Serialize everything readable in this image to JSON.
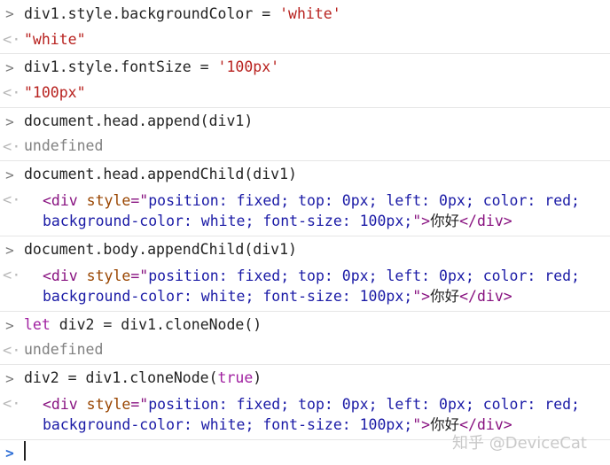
{
  "console": {
    "entries": [
      {
        "kind": "input",
        "text": "div1.style.backgroundColor = 'white'",
        "code": "div1.style.backgroundColor = ",
        "str": "'white'"
      },
      {
        "kind": "output",
        "text": "\"white\""
      },
      {
        "kind": "input",
        "text": "div1.style.fontSize = '100px'",
        "code": "div1.style.fontSize = ",
        "str": "'100px'"
      },
      {
        "kind": "output",
        "text": "\"100px\""
      },
      {
        "kind": "input",
        "text": "document.head.append(div1)"
      },
      {
        "kind": "output",
        "text": "undefined"
      },
      {
        "kind": "input",
        "text": "document.head.appendChild(div1)"
      },
      {
        "kind": "output-element",
        "open": "<div",
        "attr_name": " style",
        "eq": "=\"",
        "line1_value": "position: fixed; top: 0px; left: 0px; color: red;",
        "line2_value": "background-color: white; font-size: 100px;",
        "close_quote": "\">",
        "content": "你好",
        "close_tag": "</div>"
      },
      {
        "kind": "input",
        "text": "document.body.appendChild(div1)"
      },
      {
        "kind": "output-element",
        "open": "<div",
        "attr_name": " style",
        "eq": "=\"",
        "line1_value": "position: fixed; top: 0px; left: 0px; color: red;",
        "line2_value": "background-color: white; font-size: 100px;",
        "close_quote": "\">",
        "content": "你好",
        "close_tag": "</div>"
      },
      {
        "kind": "input",
        "text": "let div2 = div1.cloneNode()",
        "keyword": "let",
        "code": " div2 = div1.cloneNode()"
      },
      {
        "kind": "output",
        "text": "undefined"
      },
      {
        "kind": "input",
        "text": "div2 = div1.cloneNode(true)",
        "code_before": "div2 = div1.cloneNode(",
        "keyword": "true",
        "code_after": ")"
      },
      {
        "kind": "output-element",
        "open": "<div",
        "attr_name": " style",
        "eq": "=\"",
        "line1_value": "position: fixed; top: 0px; left: 0px; color: red;",
        "line2_value": "background-color: white; font-size: 100px;",
        "close_quote": "\">",
        "content": "你好",
        "close_tag": "</div>"
      }
    ],
    "prompt_symbol": ">",
    "output_symbol": "<·"
  },
  "watermark": "知乎 @DeviceCat",
  "colors": {
    "string": "#b8221f",
    "tag": "#881280",
    "attr_name": "#994500",
    "attr_value": "#1a1aa6",
    "keyword": "#a01fa0",
    "prompt_active": "#2f6fd6"
  }
}
